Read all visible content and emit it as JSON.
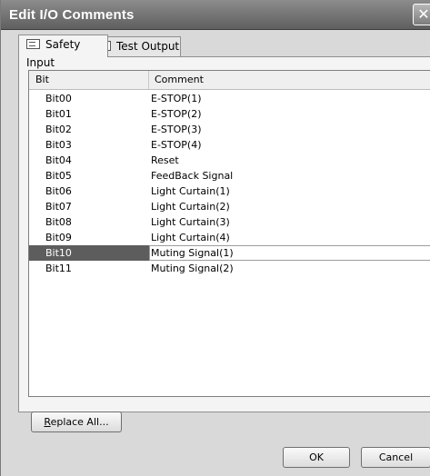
{
  "window": {
    "title": "Edit I/O Comments",
    "close_glyph": "✕"
  },
  "tabs": [
    {
      "label": "Safety Input",
      "icon": "io-module-icon",
      "active": true
    },
    {
      "label": "Test Output",
      "icon": "io-module-icon",
      "active": false
    }
  ],
  "table": {
    "columns": {
      "bit": "Bit",
      "comment": "Comment"
    },
    "rows": [
      {
        "bit": "Bit00",
        "comment": "E-STOP(1)"
      },
      {
        "bit": "Bit01",
        "comment": "E-STOP(2)"
      },
      {
        "bit": "Bit02",
        "comment": "E-STOP(3)"
      },
      {
        "bit": "Bit03",
        "comment": "E-STOP(4)"
      },
      {
        "bit": "Bit04",
        "comment": "Reset"
      },
      {
        "bit": "Bit05",
        "comment": "FeedBack Signal"
      },
      {
        "bit": "Bit06",
        "comment": "Light Curtain(1)"
      },
      {
        "bit": "Bit07",
        "comment": "Light Curtain(2)"
      },
      {
        "bit": "Bit08",
        "comment": "Light Curtain(3)"
      },
      {
        "bit": "Bit09",
        "comment": "Light Curtain(4)"
      },
      {
        "bit": "Bit10",
        "comment": "Muting Signal(1)",
        "selected": true
      },
      {
        "bit": "Bit11",
        "comment": "Muting Signal(2)"
      }
    ]
  },
  "buttons": {
    "replace_all_mnemonic": "R",
    "replace_all_rest": "eplace All...",
    "ok": "OK",
    "cancel": "Cancel"
  },
  "colors": {
    "titlebar": "#6f6f6f",
    "selection": "#5d5d5d",
    "dialog_bg": "#d9d9d9"
  }
}
